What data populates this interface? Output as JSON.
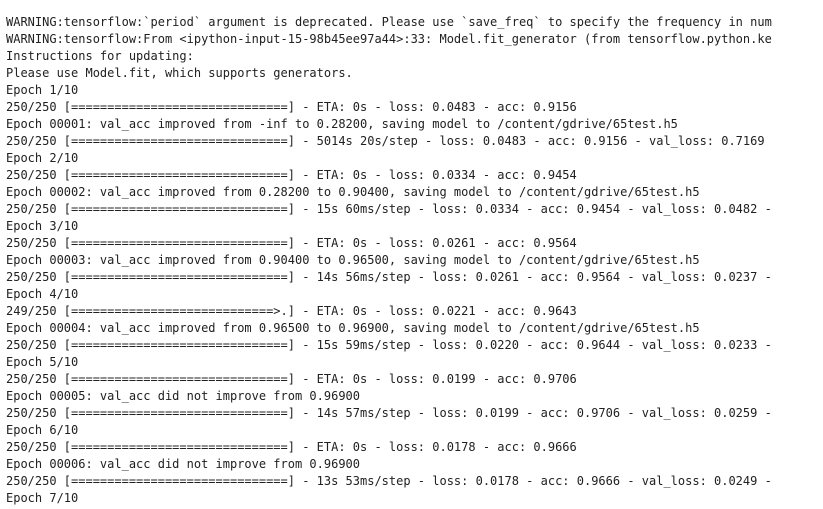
{
  "colors": {
    "background": "#ffffff",
    "text": "#212121"
  },
  "output": {
    "lines": [
      {
        "kind": "warning",
        "text": "WARNING:tensorflow:`period` argument is deprecated. Please use `save_freq` to specify the frequency in num"
      },
      {
        "kind": "warning",
        "text": "WARNING:tensorflow:From <ipython-input-15-98b45ee97a44>:33: Model.fit_generator (from tensorflow.python.ke"
      },
      {
        "kind": "warning",
        "text": "Instructions for updating:"
      },
      {
        "kind": "warning",
        "text": "Please use Model.fit, which supports generators."
      },
      {
        "kind": "epoch-header",
        "text": "Epoch 1/10"
      },
      {
        "kind": "progress",
        "text": "250/250 [==============================] - ETA: 0s - loss: 0.0483 - acc: 0.9156"
      },
      {
        "kind": "checkpoint",
        "text": "Epoch 00001: val_acc improved from -inf to 0.28200, saving model to /content/gdrive/65test.h5"
      },
      {
        "kind": "progress",
        "text": "250/250 [==============================] - 5014s 20s/step - loss: 0.0483 - acc: 0.9156 - val_loss: 0.7169"
      },
      {
        "kind": "epoch-header",
        "text": "Epoch 2/10"
      },
      {
        "kind": "progress",
        "text": "250/250 [==============================] - ETA: 0s - loss: 0.0334 - acc: 0.9454"
      },
      {
        "kind": "checkpoint",
        "text": "Epoch 00002: val_acc improved from 0.28200 to 0.90400, saving model to /content/gdrive/65test.h5"
      },
      {
        "kind": "progress",
        "text": "250/250 [==============================] - 15s 60ms/step - loss: 0.0334 - acc: 0.9454 - val_loss: 0.0482 -"
      },
      {
        "kind": "epoch-header",
        "text": "Epoch 3/10"
      },
      {
        "kind": "progress",
        "text": "250/250 [==============================] - ETA: 0s - loss: 0.0261 - acc: 0.9564"
      },
      {
        "kind": "checkpoint",
        "text": "Epoch 00003: val_acc improved from 0.90400 to 0.96500, saving model to /content/gdrive/65test.h5"
      },
      {
        "kind": "progress",
        "text": "250/250 [==============================] - 14s 56ms/step - loss: 0.0261 - acc: 0.9564 - val_loss: 0.0237 -"
      },
      {
        "kind": "epoch-header",
        "text": "Epoch 4/10"
      },
      {
        "kind": "progress",
        "text": "249/250 [============================>.] - ETA: 0s - loss: 0.0221 - acc: 0.9643"
      },
      {
        "kind": "checkpoint",
        "text": "Epoch 00004: val_acc improved from 0.96500 to 0.96900, saving model to /content/gdrive/65test.h5"
      },
      {
        "kind": "progress",
        "text": "250/250 [==============================] - 15s 59ms/step - loss: 0.0220 - acc: 0.9644 - val_loss: 0.0233 -"
      },
      {
        "kind": "epoch-header",
        "text": "Epoch 5/10"
      },
      {
        "kind": "progress",
        "text": "250/250 [==============================] - ETA: 0s - loss: 0.0199 - acc: 0.9706"
      },
      {
        "kind": "checkpoint",
        "text": "Epoch 00005: val_acc did not improve from 0.96900"
      },
      {
        "kind": "progress",
        "text": "250/250 [==============================] - 14s 57ms/step - loss: 0.0199 - acc: 0.9706 - val_loss: 0.0259 -"
      },
      {
        "kind": "epoch-header",
        "text": "Epoch 6/10"
      },
      {
        "kind": "progress",
        "text": "250/250 [==============================] - ETA: 0s - loss: 0.0178 - acc: 0.9666"
      },
      {
        "kind": "checkpoint",
        "text": "Epoch 00006: val_acc did not improve from 0.96900"
      },
      {
        "kind": "progress",
        "text": "250/250 [==============================] - 13s 53ms/step - loss: 0.0178 - acc: 0.9666 - val_loss: 0.0249 -"
      },
      {
        "kind": "epoch-header",
        "text": "Epoch 7/10"
      }
    ]
  }
}
